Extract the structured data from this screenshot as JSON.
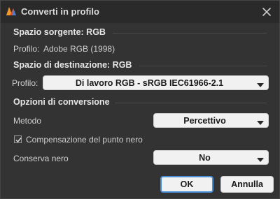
{
  "dialog": {
    "title": "Converti in profilo",
    "app_icon": "photoshop-app-icon",
    "close_icon": "close-icon"
  },
  "source": {
    "heading": "Spazio sorgente: RGB",
    "profile_label": "Profilo:",
    "profile_value": "Adobe RGB (1998)"
  },
  "destination": {
    "heading": "Spazio di destinazione: RGB",
    "profile_label": "Profilo:",
    "profile_selected": "Di lavoro RGB - sRGB IEC61966-2.1"
  },
  "options": {
    "heading": "Opzioni di conversione",
    "method_label": "Metodo",
    "method_selected": "Percettivo",
    "black_point_label": "Compensazione del punto nero",
    "black_point_checked": true,
    "preserve_black_label": "Conserva nero",
    "preserve_black_selected": "No"
  },
  "buttons": {
    "ok_label": "OK",
    "cancel_label": "Annulla"
  },
  "colors": {
    "accent": "#4a8fd6",
    "background": "#333333"
  }
}
